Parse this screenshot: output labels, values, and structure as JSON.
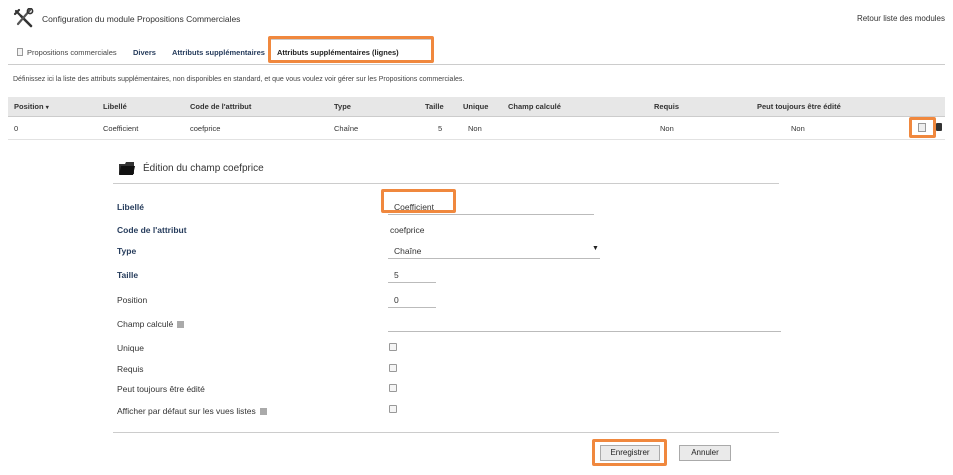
{
  "header": {
    "title": "Configuration du module Propositions Commerciales",
    "back_link": "Retour liste des modules"
  },
  "tabs": [
    {
      "label": "Propositions commerciales"
    },
    {
      "label": "Divers"
    },
    {
      "label": "Attributs supplémentaires"
    },
    {
      "label": "Attributs supplémentaires (lignes)"
    }
  ],
  "description": "Définissez ici la liste des attributs supplémentaires, non disponibles en standard, et que vous voulez voir gérer sur les Propositions commerciales.",
  "table": {
    "headers": {
      "position": "Position",
      "libelle": "Libellé",
      "code": "Code de l'attribut",
      "type": "Type",
      "taille": "Taille",
      "unique": "Unique",
      "champ_calcule": "Champ calculé",
      "requis": "Requis",
      "peut_toujours": "Peut toujours être édité"
    },
    "rows": [
      {
        "position": "0",
        "libelle": "Coefficient",
        "code": "coefprice",
        "type": "Chaîne",
        "taille": "5",
        "unique": "Non",
        "champ_calcule": "",
        "requis": "Non",
        "peut_toujours": "Non"
      }
    ]
  },
  "form": {
    "title": "Édition du champ coefprice",
    "fields": {
      "libelle": {
        "label": "Libellé",
        "value": "Coefficient"
      },
      "code": {
        "label": "Code de l'attribut",
        "value": "coefprice"
      },
      "type": {
        "label": "Type",
        "value": "Chaîne"
      },
      "taille": {
        "label": "Taille",
        "value": "5"
      },
      "position": {
        "label": "Position",
        "value": "0"
      },
      "champ_calcule": {
        "label": "Champ calculé",
        "value": ""
      },
      "unique": {
        "label": "Unique",
        "checked": false
      },
      "requis": {
        "label": "Requis",
        "checked": false
      },
      "peut_toujours": {
        "label": "Peut toujours être édité",
        "checked": false
      },
      "afficher_defaut": {
        "label": "Afficher par défaut sur les vues listes",
        "checked": false
      }
    },
    "buttons": {
      "save": "Enregistrer",
      "cancel": "Annuler"
    }
  },
  "colors": {
    "highlight": "#f0883e",
    "header_bg": "#e7e7e7",
    "link": "#263c5c"
  },
  "icons": [
    "tools-icon",
    "document-icon",
    "edit-icon",
    "delete-icon",
    "folder-icon",
    "help-icon"
  ]
}
